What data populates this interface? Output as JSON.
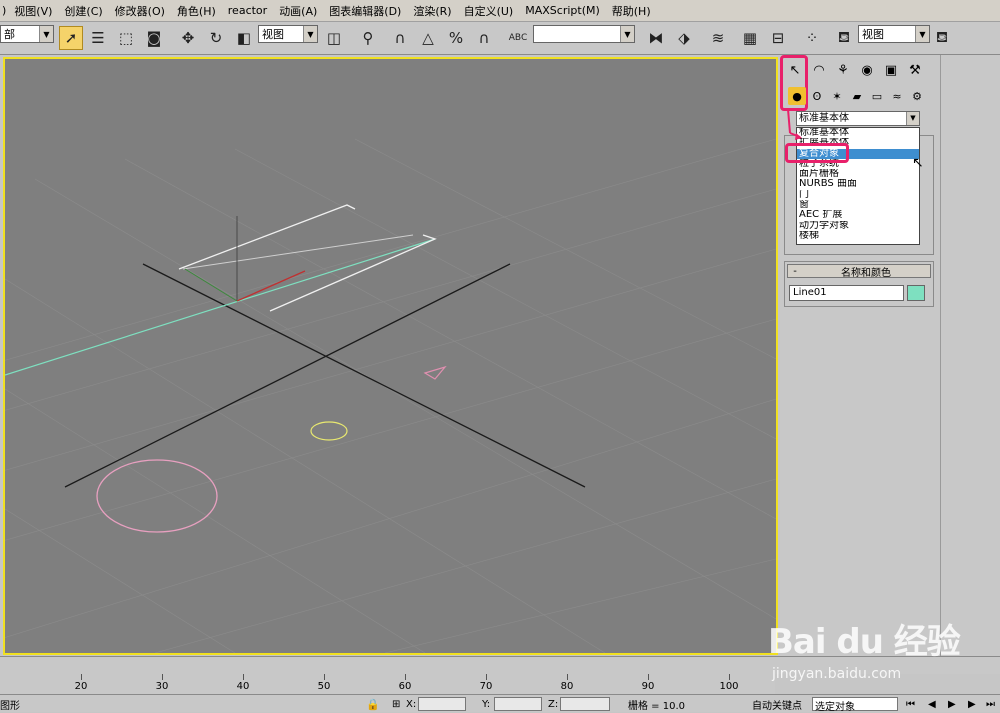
{
  "menu": [
    "视图(V)",
    "创建(C)",
    "修改器(O)",
    "角色(H)",
    "reactor",
    "动画(A)",
    "图表编辑器(D)",
    "渲染(R)",
    "自定义(U)",
    "MAXScript(M)",
    "帮助(H)"
  ],
  "menu_prefix": ")",
  "toolbar": {
    "selection_filter": "部",
    "ref_coord": "视图",
    "named_selection": "",
    "render_view": "视图",
    "abc_label": "ABC"
  },
  "panel": {
    "category_combo": "标准基本体",
    "dropdown_options": [
      "标准基本体",
      "扩展基本体",
      "复合对象",
      "粒子系统",
      "面片栅格",
      "NURBS 曲面",
      "门",
      "窗",
      "AEC 扩展",
      "动力学对象",
      "楼梯"
    ],
    "highlighted_index": 2,
    "name_color_header": "名称和颜色",
    "name_value": "Line01",
    "object_color": "#7ee0c0"
  },
  "ruler": {
    "labels": [
      "20",
      "30",
      "40",
      "50",
      "60",
      "70",
      "80",
      "90",
      "100"
    ]
  },
  "status": {
    "left_text": "图形",
    "x_label": "X:",
    "y_label": "Y:",
    "z_label": "Z:",
    "grid_text": "栅格 = 10.0",
    "autokey": "自动关键点",
    "selected_combo": "选定对象"
  },
  "watermark": {
    "brand": "Bai du 经验",
    "url": "jingyan.baidu.com"
  },
  "colors": {
    "viewport_bg": "#7f7f7f",
    "viewport_border": "#f0e020",
    "highlight": "#e8206a"
  }
}
